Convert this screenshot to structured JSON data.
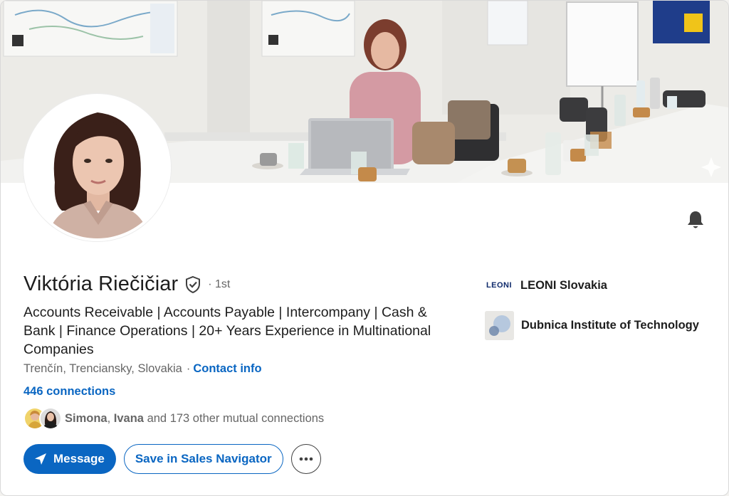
{
  "profile": {
    "name": "Viktória Riečičiar",
    "degree": "· 1st",
    "headline": "Accounts Receivable | Accounts Payable | Intercompany | Cash & Bank | Finance Operations | 20+ Years Experience in Multinational Companies",
    "location": "Trenčín, Trenciansky, Slovakia",
    "contact_info": "Contact info",
    "connections": "446 connections",
    "mutual": {
      "name1": "Simona",
      "name2": "Ivana",
      "rest": "and 173 other mutual connections"
    }
  },
  "actions": {
    "message": "Message",
    "save_sales_nav": "Save in Sales Navigator"
  },
  "experience": {
    "company_logo_text": "LEONI",
    "company": "LEONI Slovakia",
    "school": "Dubnica Institute of Technology"
  },
  "colors": {
    "brand_blue": "#0a66c2",
    "text_primary": "#1d1d1d",
    "text_secondary": "#666666"
  },
  "icons": [
    "bell-icon",
    "verified-icon",
    "send-icon",
    "more-icon"
  ]
}
